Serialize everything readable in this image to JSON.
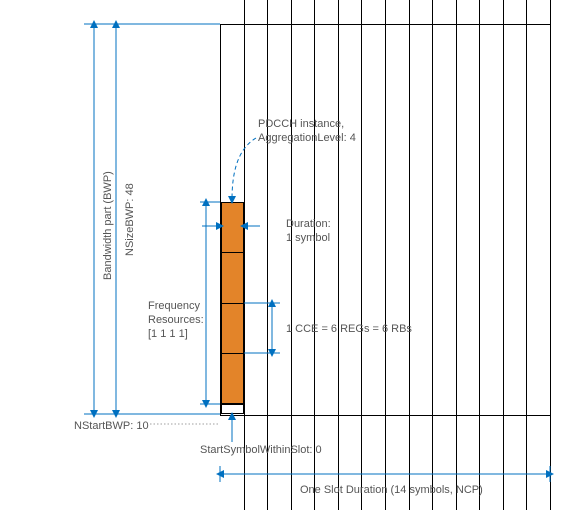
{
  "labels": {
    "bwp": "Bandwidth part (BWP)",
    "nsize": "NSizeBWP: 48",
    "nstart": "NStartBWP: 10",
    "startSym": "StartSymbolWithinSlot: 0",
    "slot": "One Slot Duration (14 symbols, NCP)",
    "freqRes1": "Frequency",
    "freqRes2": "Resources:",
    "freqRes3": "[1 1 1 1]",
    "pdcch1": "PDCCH instance,",
    "pdcch2": "AggregationLevel: 4",
    "dur1": "Duration:",
    "dur2": "1 symbol",
    "cce": "1 CCE = 6 REGs = 6 RBs"
  },
  "chart_data": {
    "type": "diagram",
    "title": "PDCCH resource mapping within BWP/slot",
    "NStartBWP": 10,
    "NSizeBWP": 48,
    "StartSymbolWithinSlot": 0,
    "Duration_symbols": 1,
    "AggregationLevel": 4,
    "FrequencyResources": [
      1,
      1,
      1,
      1
    ],
    "CCE_equivalence": {
      "REGs": 6,
      "RBs": 6
    },
    "slot_symbols": 14,
    "cp": "NCP",
    "grid_columns": 14
  }
}
